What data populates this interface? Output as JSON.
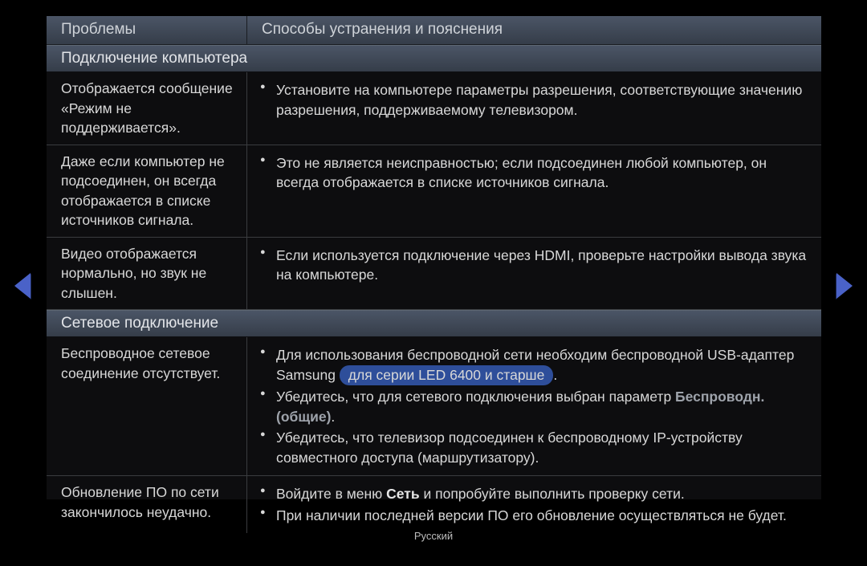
{
  "header": {
    "problems": "Проблемы",
    "solutions": "Способы устранения и пояснения"
  },
  "section1": "Подключение компьютера",
  "rows1": [
    {
      "left": "Отображается сообщение «Режим не поддерживается».",
      "bullets": [
        "Установите на компьютере параметры разрешения, соответствующие значению разрешения, поддерживаемому телевизором."
      ]
    },
    {
      "left": "Даже если компьютер не подсоединен, он всегда отображается в списке источников сигнала.",
      "bullets": [
        "Это не является неисправностью; если подсоединен любой компьютер, он всегда отображается в списке источников сигнала."
      ]
    },
    {
      "left": "Видео отображается нормально, но звук не слышен.",
      "bullets": [
        "Если используется подключение через HDMI, проверьте настройки вывода звука на компьютере."
      ]
    }
  ],
  "section2": "Сетевое подключение",
  "rows2": [
    {
      "left": "Беспроводное сетевое соединение отсутствует.",
      "bullets_complex": {
        "b1_part1": "Для использования беспроводной сети необходим беспроводной USB-адаптер Samsung ",
        "b1_pill": " для серии LED 6400 и старше ",
        "b1_pill_trail": ".",
        "b2_text": "Убедитесь, что для сетевого подключения выбран параметр ",
        "b2_bold": "Беспроводн. (общие)",
        "b2_trail": ".",
        "b3": "Убедитесь, что телевизор подсоединен к беспроводному IP-устройству совместного доступа (маршрутизатору)."
      }
    },
    {
      "left": "Обновление ПО по сети закончилось неудачно.",
      "bullets_complex2": {
        "b1_pre": "Войдите в меню ",
        "b1_bold": "Сеть",
        "b1_post": " и попробуйте выполнить проверку сети.",
        "b2": "При наличии последней версии ПО его обновление осуществляться не будет."
      }
    }
  ],
  "footer": "Русский"
}
